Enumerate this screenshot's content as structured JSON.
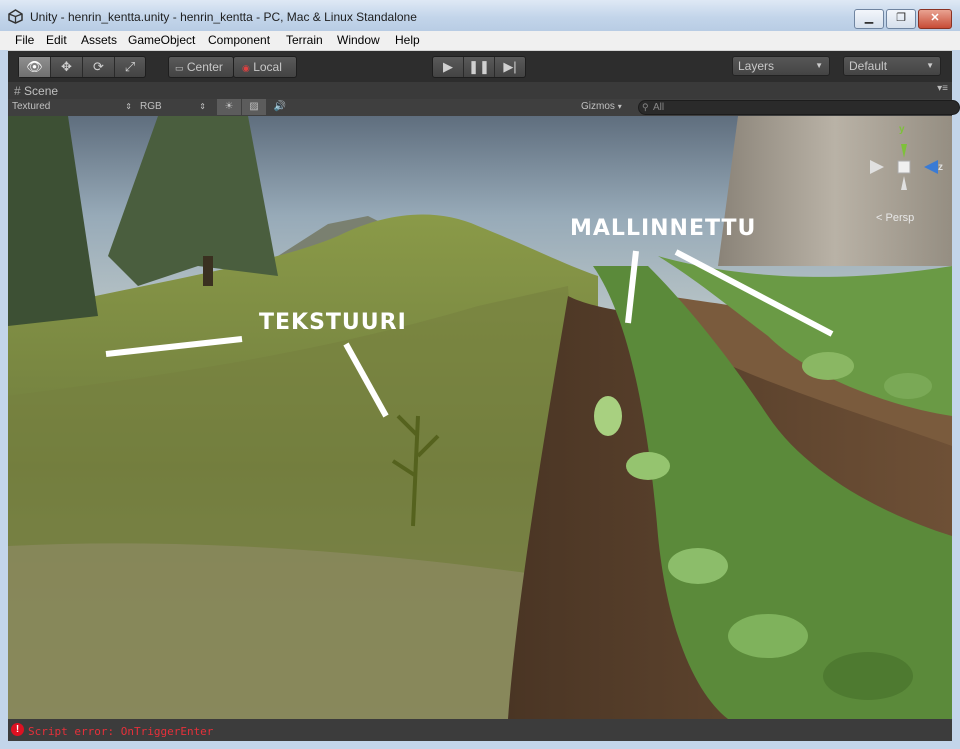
{
  "window": {
    "title": "Unity - henrin_kentta.unity - henrin_kentta - PC, Mac & Linux Standalone",
    "minimize": "▁",
    "maximize": "❐",
    "close": "✕"
  },
  "menu": [
    "File",
    "Edit",
    "Assets",
    "GameObject",
    "Component",
    "Terrain",
    "Window",
    "Help"
  ],
  "toolbar": {
    "pivot_label": "Center",
    "space_label": "Local",
    "layers_label": "Layers",
    "layout_label": "Default"
  },
  "scene": {
    "tab_label": "Scene",
    "render_mode": "Textured",
    "color_mode": "RGB",
    "gizmos_label": "Gizmos",
    "search_placeholder": "All",
    "axis_y": "y",
    "axis_z": "z",
    "persp_label": "Persp",
    "annotation_texture": "TEKSTUURI",
    "annotation_model": "MALLINNETTU"
  },
  "status": {
    "message": "Script error: OnTriggerEnter",
    "error_color": "#e6303a"
  }
}
